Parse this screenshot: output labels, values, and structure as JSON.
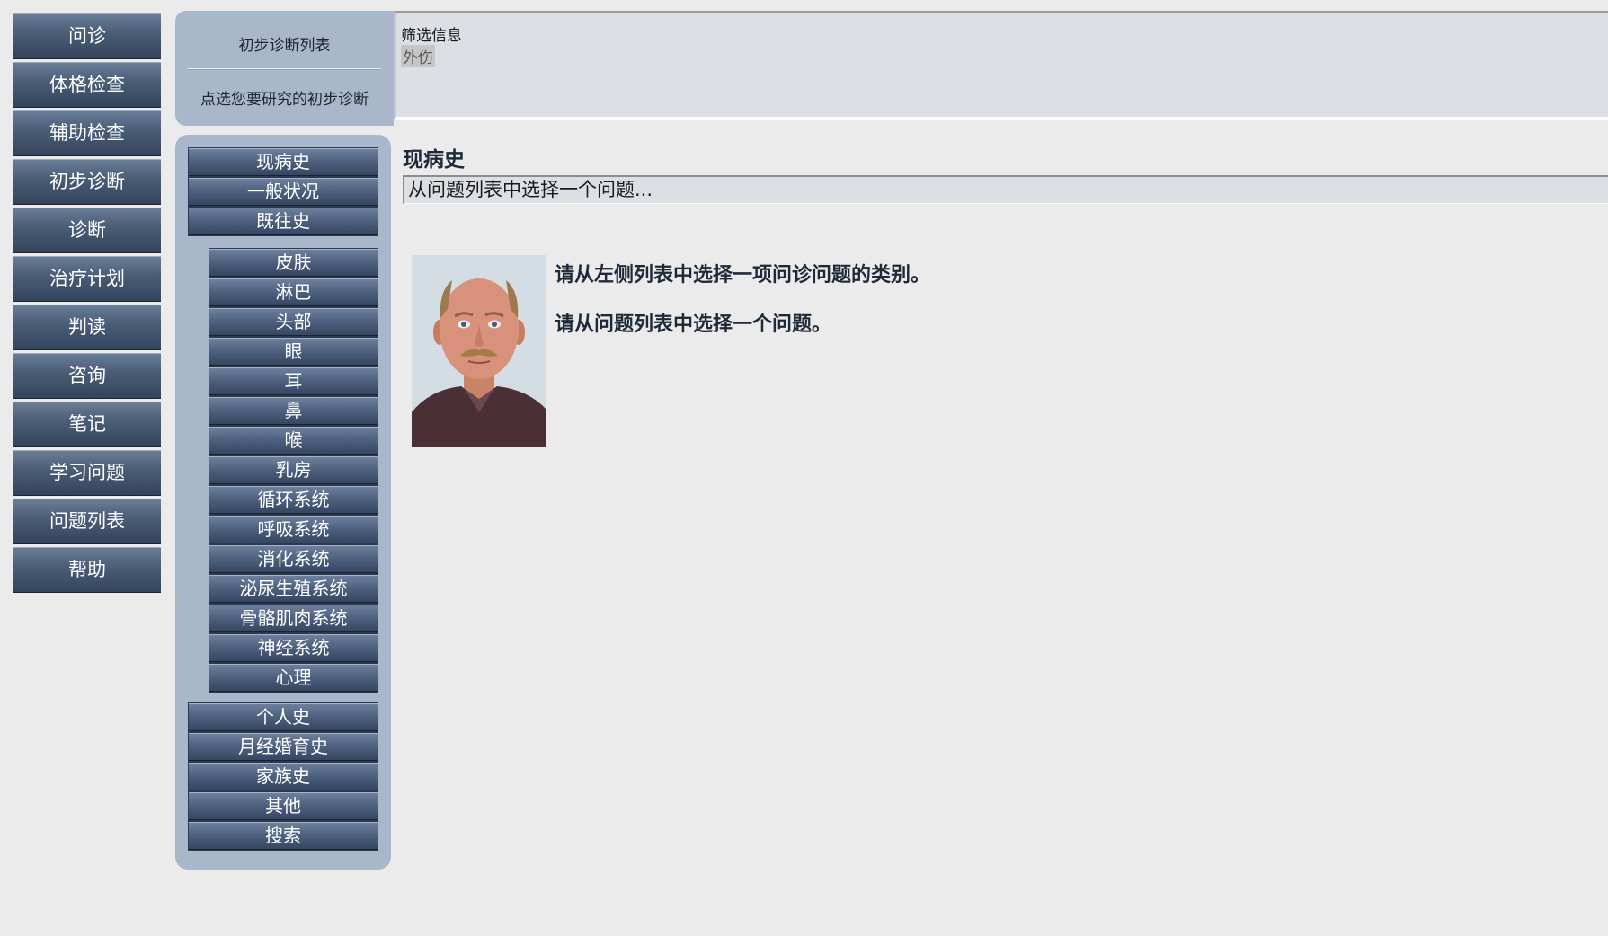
{
  "main_nav": {
    "items": [
      {
        "label": "问诊"
      },
      {
        "label": "体格检查"
      },
      {
        "label": "辅助检查"
      },
      {
        "label": "初步诊断"
      },
      {
        "label": "诊断"
      },
      {
        "label": "治疗计划"
      },
      {
        "label": "判读"
      },
      {
        "label": "咨询"
      },
      {
        "label": "笔记"
      },
      {
        "label": "学习问题"
      },
      {
        "label": "问题列表"
      },
      {
        "label": "帮助"
      }
    ]
  },
  "diagnosis_panel": {
    "title": "初步诊断列表",
    "hint": "点选您要研究的初步诊断"
  },
  "filter": {
    "label": "筛选信息",
    "tag": "外伤"
  },
  "categories": {
    "top": [
      {
        "label": "现病史"
      },
      {
        "label": "一般状况"
      },
      {
        "label": "既往史"
      }
    ],
    "systems": [
      {
        "label": "皮肤"
      },
      {
        "label": "淋巴"
      },
      {
        "label": "头部"
      },
      {
        "label": "眼"
      },
      {
        "label": "耳"
      },
      {
        "label": "鼻"
      },
      {
        "label": "喉"
      },
      {
        "label": "乳房"
      },
      {
        "label": "循环系统"
      },
      {
        "label": "呼吸系统"
      },
      {
        "label": "消化系统"
      },
      {
        "label": "泌尿生殖系统"
      },
      {
        "label": "骨骼肌肉系统"
      },
      {
        "label": "神经系统"
      },
      {
        "label": "心理"
      }
    ],
    "bottom": [
      {
        "label": "个人史"
      },
      {
        "label": "月经婚育史"
      },
      {
        "label": "家族史"
      },
      {
        "label": "其他"
      },
      {
        "label": "搜索"
      }
    ]
  },
  "content": {
    "section_title": "现病史",
    "question_select_placeholder": "从问题列表中选择一个问题...",
    "instruction_1": "请从左侧列表中选择一项问诊问题的类别。",
    "instruction_2": "请从问题列表中选择一个问题。"
  },
  "colors": {
    "panel_bg": "#a8b7c9",
    "button_top": "#6c7f99",
    "button_bottom": "#33435b",
    "page_bg": "#ebebeb"
  }
}
